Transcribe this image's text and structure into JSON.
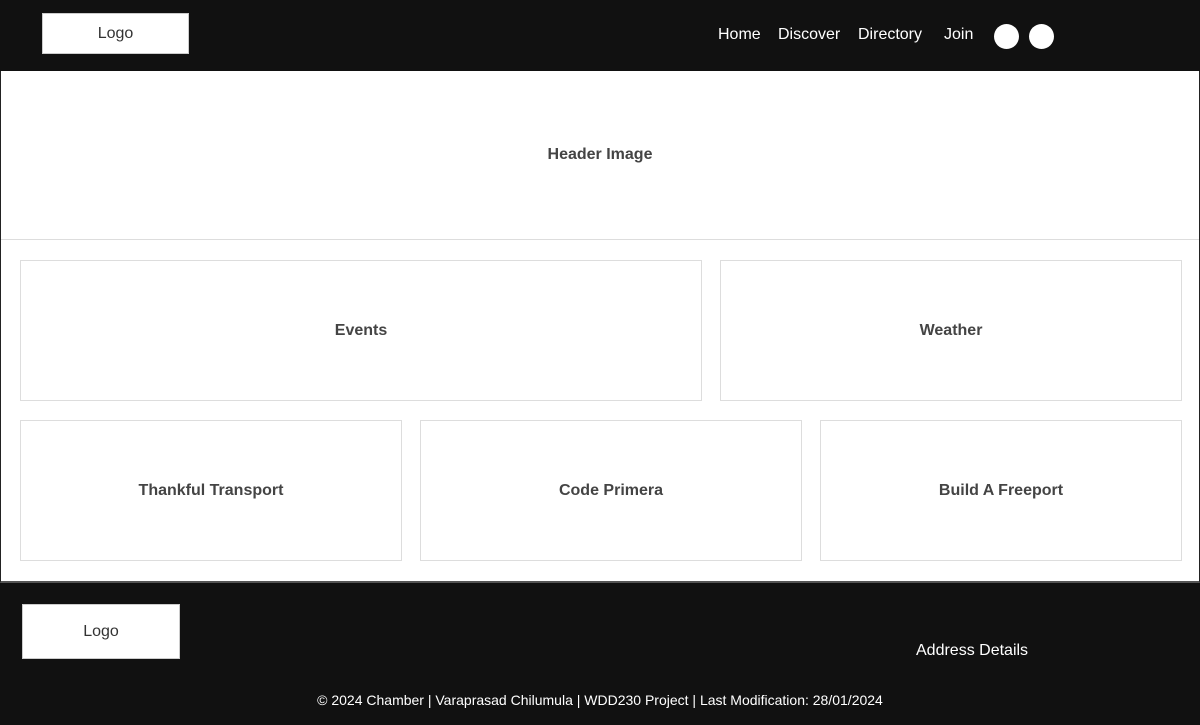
{
  "header": {
    "logo_text": "Logo",
    "nav": {
      "home": "Home",
      "discover": "Discover",
      "directory": "Directory",
      "join": "Join"
    },
    "social_icons": [
      "social-icon-1",
      "social-icon-2"
    ]
  },
  "main": {
    "hero_label": "Header Image",
    "cards": {
      "events": "Events",
      "weather": "Weather",
      "spotlight_1": "Thankful Transport",
      "spotlight_2": "Code Primera",
      "spotlight_3": "Build A Freeport"
    }
  },
  "footer": {
    "logo_text": "Logo",
    "address": "Address Details",
    "copyright": "© 2024 Chamber | Varaprasad Chilumula | WDD230 Project | Last Modification: 28/01/2024"
  },
  "colors": {
    "bar_background": "#111111",
    "text_on_dark": "#ffffff",
    "card_text": "#444444",
    "card_border": "#dddddd"
  }
}
